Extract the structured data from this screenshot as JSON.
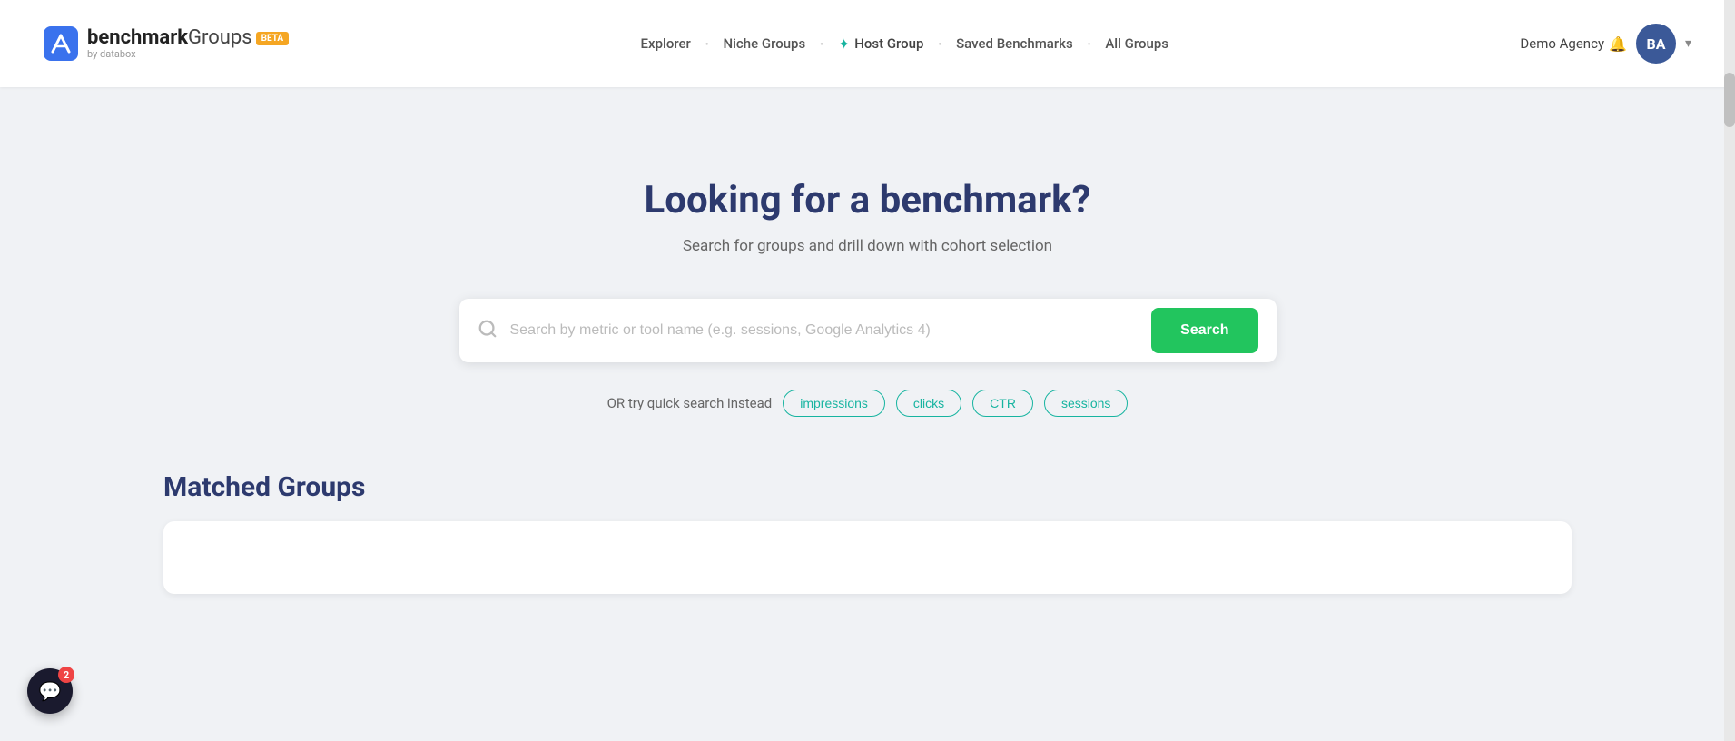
{
  "header": {
    "logo": {
      "brand": "benchmark",
      "product": "Groups",
      "beta_label": "BETA",
      "by_text": "by databox"
    },
    "nav": {
      "items": [
        {
          "id": "explorer",
          "label": "Explorer",
          "has_dot_before": false
        },
        {
          "id": "niche-groups",
          "label": "Niche Groups",
          "has_dot_before": true
        },
        {
          "id": "host-group",
          "label": "Host Group",
          "has_dot_before": true,
          "has_sparkle": true
        },
        {
          "id": "saved-benchmarks",
          "label": "Saved Benchmarks",
          "has_dot_before": true
        },
        {
          "id": "all-groups",
          "label": "All Groups",
          "has_dot_before": true
        }
      ]
    },
    "user": {
      "name": "Demo Agency",
      "initials": "BA",
      "avatar_color": "#3b5998"
    }
  },
  "hero": {
    "title": "Looking for a benchmark?",
    "subtitle": "Search for groups and drill down with cohort selection"
  },
  "search": {
    "placeholder": "Search by metric or tool name (e.g. sessions, Google Analytics 4)",
    "button_label": "Search"
  },
  "quick_search": {
    "label": "OR try quick search instead",
    "tags": [
      {
        "id": "impressions",
        "label": "impressions"
      },
      {
        "id": "clicks",
        "label": "clicks"
      },
      {
        "id": "ctr",
        "label": "CTR"
      },
      {
        "id": "sessions",
        "label": "sessions"
      }
    ]
  },
  "matched_section": {
    "title": "Matched Groups"
  },
  "chat_widget": {
    "badge_count": "2"
  }
}
